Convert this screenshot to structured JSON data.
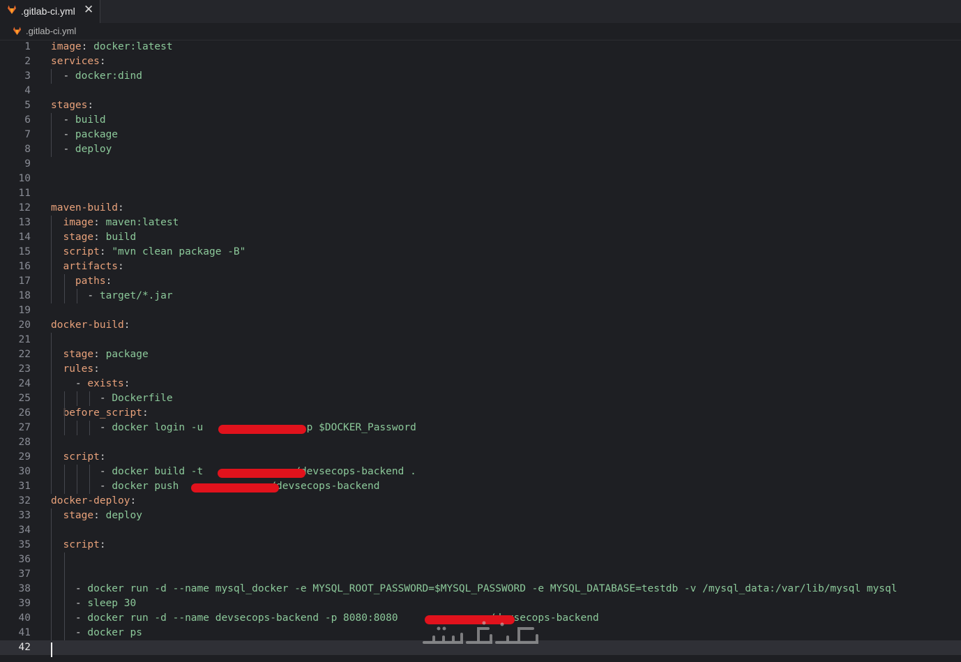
{
  "tab": {
    "title": ".gitlab-ci.yml",
    "close_symbol": "✕"
  },
  "breadcrumb": {
    "file": ".gitlab-ci.yml"
  },
  "colors": {
    "key": "#e9a27b",
    "value": "#8cc99a",
    "redaction": "#e1121c",
    "gitlab_logo": "#e2672c"
  },
  "editor": {
    "current_line": "42",
    "lines": [
      {
        "n": "1",
        "t": [
          [
            "image",
            "k"
          ],
          [
            ": ",
            "p"
          ],
          [
            "docker:latest",
            "v"
          ]
        ]
      },
      {
        "n": "2",
        "t": [
          [
            "services",
            "k"
          ],
          [
            ":",
            "p"
          ]
        ]
      },
      {
        "n": "3",
        "t": [
          [
            "  - ",
            "p"
          ],
          [
            "docker:dind",
            "v"
          ]
        ]
      },
      {
        "n": "4",
        "t": []
      },
      {
        "n": "5",
        "t": [
          [
            "stages",
            "k"
          ],
          [
            ":",
            "p"
          ]
        ]
      },
      {
        "n": "6",
        "t": [
          [
            "  - ",
            "p"
          ],
          [
            "build",
            "v"
          ]
        ]
      },
      {
        "n": "7",
        "t": [
          [
            "  - ",
            "p"
          ],
          [
            "package",
            "v"
          ]
        ]
      },
      {
        "n": "8",
        "t": [
          [
            "  - ",
            "p"
          ],
          [
            "deploy",
            "v"
          ]
        ]
      },
      {
        "n": "9",
        "t": []
      },
      {
        "n": "10",
        "t": []
      },
      {
        "n": "11",
        "t": []
      },
      {
        "n": "12",
        "t": [
          [
            "maven-build",
            "k"
          ],
          [
            ":",
            "p"
          ]
        ]
      },
      {
        "n": "13",
        "t": [
          [
            "  ",
            "p"
          ],
          [
            "image",
            "k"
          ],
          [
            ": ",
            "p"
          ],
          [
            "maven:latest",
            "v"
          ]
        ]
      },
      {
        "n": "14",
        "t": [
          [
            "  ",
            "p"
          ],
          [
            "stage",
            "k"
          ],
          [
            ": ",
            "p"
          ],
          [
            "build",
            "v"
          ]
        ]
      },
      {
        "n": "15",
        "t": [
          [
            "  ",
            "p"
          ],
          [
            "script",
            "k"
          ],
          [
            ": ",
            "p"
          ],
          [
            "\"mvn clean package -B\"",
            "v"
          ]
        ]
      },
      {
        "n": "16",
        "t": [
          [
            "  ",
            "p"
          ],
          [
            "artifacts",
            "k"
          ],
          [
            ":",
            "p"
          ]
        ]
      },
      {
        "n": "17",
        "t": [
          [
            "    ",
            "p"
          ],
          [
            "paths",
            "k"
          ],
          [
            ":",
            "p"
          ]
        ]
      },
      {
        "n": "18",
        "t": [
          [
            "      - ",
            "p"
          ],
          [
            "target/*.jar",
            "v"
          ]
        ]
      },
      {
        "n": "19",
        "t": []
      },
      {
        "n": "20",
        "t": [
          [
            "docker-build",
            "k"
          ],
          [
            ":",
            "p"
          ]
        ]
      },
      {
        "n": "21",
        "t": []
      },
      {
        "n": "22",
        "t": [
          [
            "  ",
            "p"
          ],
          [
            "stage",
            "k"
          ],
          [
            ": ",
            "p"
          ],
          [
            "package",
            "v"
          ]
        ]
      },
      {
        "n": "23",
        "t": [
          [
            "  ",
            "p"
          ],
          [
            "rules",
            "k"
          ],
          [
            ":",
            "p"
          ]
        ]
      },
      {
        "n": "24",
        "t": [
          [
            "    - ",
            "p"
          ],
          [
            "exists",
            "k"
          ],
          [
            ":",
            "p"
          ]
        ]
      },
      {
        "n": "25",
        "t": [
          [
            "        - ",
            "p"
          ],
          [
            "Dockerfile",
            "v"
          ]
        ]
      },
      {
        "n": "26",
        "t": [
          [
            "  ",
            "p"
          ],
          [
            "before_script",
            "k"
          ],
          [
            ":",
            "p"
          ]
        ]
      },
      {
        "n": "27",
        "t": [
          [
            "        - ",
            "p"
          ],
          [
            "docker login -u ",
            "v"
          ],
          [
            "              ",
            "p"
          ],
          [
            " -p $DOCKER_Password",
            "v"
          ]
        ]
      },
      {
        "n": "28",
        "t": []
      },
      {
        "n": "29",
        "t": [
          [
            "  ",
            "p"
          ],
          [
            "script",
            "k"
          ],
          [
            ":",
            "p"
          ]
        ]
      },
      {
        "n": "30",
        "t": [
          [
            "        - ",
            "p"
          ],
          [
            "docker build -t ",
            "v"
          ],
          [
            "              ",
            "p"
          ],
          [
            "/devsecops-backend .",
            "v"
          ]
        ]
      },
      {
        "n": "31",
        "t": [
          [
            "        - ",
            "p"
          ],
          [
            "docker push ",
            "v"
          ],
          [
            "              ",
            "p"
          ],
          [
            "/devsecops-backend",
            "v"
          ]
        ]
      },
      {
        "n": "32",
        "t": [
          [
            "docker-deploy",
            "k"
          ],
          [
            ":",
            "p"
          ]
        ]
      },
      {
        "n": "33",
        "t": [
          [
            "  ",
            "p"
          ],
          [
            "stage",
            "k"
          ],
          [
            ": ",
            "p"
          ],
          [
            "deploy",
            "v"
          ]
        ]
      },
      {
        "n": "34",
        "t": []
      },
      {
        "n": "35",
        "t": [
          [
            "  ",
            "p"
          ],
          [
            "script",
            "k"
          ],
          [
            ":",
            "p"
          ]
        ]
      },
      {
        "n": "36",
        "t": []
      },
      {
        "n": "37",
        "t": []
      },
      {
        "n": "38",
        "t": [
          [
            "    - ",
            "p"
          ],
          [
            "docker run -d --name mysql_docker -e MYSQL_ROOT_PASSWORD=$MYSQL_PASSWORD -e MYSQL_DATABASE=testdb -v /mysql_data:/var/lib/mysql mysql",
            "v"
          ]
        ]
      },
      {
        "n": "39",
        "t": [
          [
            "    - ",
            "p"
          ],
          [
            "sleep 30",
            "v"
          ]
        ]
      },
      {
        "n": "40",
        "t": [
          [
            "    - ",
            "p"
          ],
          [
            "docker run -d --name devsecops-backend -p 8080:8080 ",
            "v"
          ],
          [
            "              ",
            "p"
          ],
          [
            "/devsecops-backend",
            "v"
          ]
        ]
      },
      {
        "n": "41",
        "t": [
          [
            "    - ",
            "p"
          ],
          [
            "docker ps",
            "v"
          ]
        ]
      },
      {
        "n": "42",
        "t": []
      }
    ]
  }
}
